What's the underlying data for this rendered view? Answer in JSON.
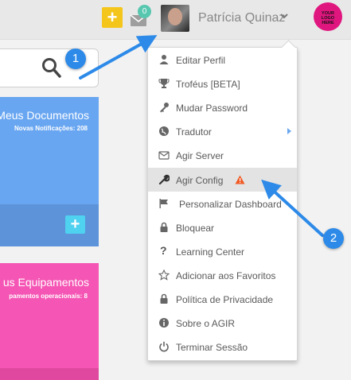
{
  "topbar": {
    "add_icon": "plus-icon",
    "mail_icon": "envelope-icon",
    "mail_count": "0",
    "user_name": "Patrícia Quinaz",
    "logo_text": "YOUR LOGO HERE",
    "accent_yellow": "#f4c51a",
    "badge_green": "#57c7b0"
  },
  "cards": [
    {
      "title": "Meus Documentos",
      "subtitle": "Novas Notificações: 208",
      "color": "#69a6f1"
    },
    {
      "title": "us Equipamentos",
      "subtitle": "pamentos operacionais: 8",
      "color": "#f555b4"
    }
  ],
  "menu": {
    "items": [
      {
        "label": "Editar Perfil",
        "icon": "user-icon"
      },
      {
        "label": "Troféus [BETA]",
        "icon": "trophy-icon"
      },
      {
        "label": "Mudar Password",
        "icon": "key-icon"
      },
      {
        "label": "Tradutor",
        "icon": "globe-icon",
        "submenu": true
      },
      {
        "label": "Agir Server",
        "icon": "envelope-icon"
      },
      {
        "label": "Agir Config",
        "icon": "wrench-icon",
        "highlighted": true,
        "warning": true
      },
      {
        "label": "Personalizar Dashboard",
        "icon": "flag-icon"
      },
      {
        "label": "Bloquear",
        "icon": "lock-icon"
      },
      {
        "label": "Learning Center",
        "icon": "question-icon"
      },
      {
        "label": "Adicionar aos Favoritos",
        "icon": "star-icon"
      },
      {
        "label": "Política de Privacidade",
        "icon": "lock-icon"
      },
      {
        "label": "Sobre o AGIR",
        "icon": "info-icon"
      },
      {
        "label": "Terminar Sessão",
        "icon": "power-icon"
      }
    ]
  },
  "callouts": [
    {
      "number": "1"
    },
    {
      "number": "2"
    }
  ],
  "callout_color": "#2d8ae8"
}
